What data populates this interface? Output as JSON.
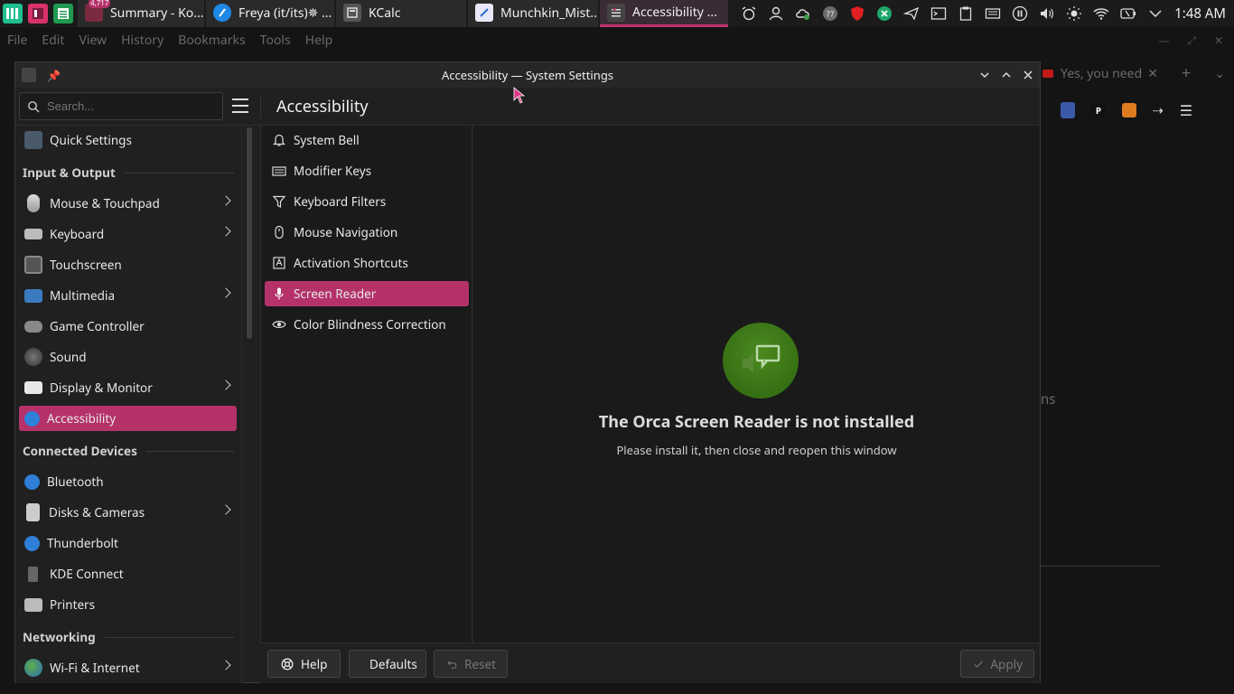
{
  "panel": {
    "apps": [
      {
        "name": "app-launcher",
        "color": "#1fbf8f"
      },
      {
        "name": "kate",
        "color": "#d8336b"
      },
      {
        "name": "spreadsheet",
        "color": "#1f9a4f"
      }
    ],
    "badge": "4,717",
    "tasks": [
      {
        "label": "Summary - Ko...",
        "color": "#c2336e",
        "active": false
      },
      {
        "label": "Freya (it/its)✵ ...",
        "color": "#1e88e5",
        "active": false
      },
      {
        "label": "KCalc",
        "color": "#555555",
        "active": false
      },
      {
        "label": "Munchkin_Mist...",
        "color": "#2b6cd6",
        "active": false
      },
      {
        "label": "Accessibility ...",
        "color": "#444444",
        "active": true
      }
    ],
    "clock": "1:48 AM"
  },
  "background_app": {
    "menu": [
      "File",
      "Edit",
      "View",
      "History",
      "Bookmarks",
      "Tools",
      "Help"
    ],
    "tab_label": "Yes, you need",
    "partial_text": "ns"
  },
  "window": {
    "title": "Accessibility — System Settings",
    "page_title": "Accessibility",
    "search_placeholder": "Search..."
  },
  "sidebar": {
    "quick_settings": "Quick Settings",
    "sections": [
      {
        "heading": "Input & Output"
      },
      {
        "heading": "Connected Devices"
      },
      {
        "heading": "Networking"
      }
    ],
    "items": [
      {
        "label": "Mouse & Touchpad"
      },
      {
        "label": "Keyboard"
      },
      {
        "label": "Touchscreen"
      },
      {
        "label": "Multimedia"
      },
      {
        "label": "Game Controller"
      },
      {
        "label": "Sound"
      },
      {
        "label": "Display & Monitor"
      },
      {
        "label": "Accessibility"
      },
      {
        "label": "Bluetooth"
      },
      {
        "label": "Disks & Cameras"
      },
      {
        "label": "Thunderbolt"
      },
      {
        "label": "KDE Connect"
      },
      {
        "label": "Printers"
      },
      {
        "label": "Wi-Fi & Internet"
      }
    ]
  },
  "modules": [
    {
      "label": "System Bell",
      "icon": "bell-icon"
    },
    {
      "label": "Modifier Keys",
      "icon": "keyboard-icon"
    },
    {
      "label": "Keyboard Filters",
      "icon": "filter-icon"
    },
    {
      "label": "Mouse Navigation",
      "icon": "mouse-icon"
    },
    {
      "label": "Activation Shortcuts",
      "icon": "shortcut-icon"
    },
    {
      "label": "Screen Reader",
      "icon": "microphone-icon"
    },
    {
      "label": "Color Blindness Correction",
      "icon": "eye-icon"
    }
  ],
  "content": {
    "title": "The Orca Screen Reader is not installed",
    "subtitle": "Please install it, then close and reopen this window"
  },
  "footer": {
    "help": "Help",
    "defaults": "Defaults",
    "reset": "Reset",
    "apply": "Apply"
  },
  "colors": {
    "accent": "#b5316a",
    "orca_green": "#3d7a18"
  }
}
